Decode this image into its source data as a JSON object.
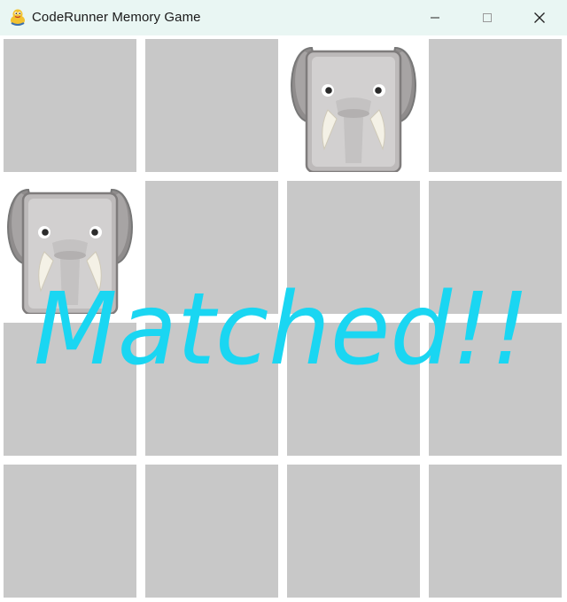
{
  "window": {
    "title": "CodeRunner Memory Game",
    "icon": "python-snake-icon",
    "controls": [
      "minimize-icon",
      "maximize-icon",
      "close-icon"
    ]
  },
  "board": {
    "rows": 4,
    "cols": 4,
    "hidden_color": "#c8c8c8",
    "tiles": [
      {
        "row": 0,
        "col": 0,
        "state": "hidden"
      },
      {
        "row": 0,
        "col": 1,
        "state": "hidden"
      },
      {
        "row": 0,
        "col": 2,
        "state": "revealed",
        "image": "elephant-icon"
      },
      {
        "row": 0,
        "col": 3,
        "state": "hidden"
      },
      {
        "row": 1,
        "col": 0,
        "state": "revealed",
        "image": "elephant-icon"
      },
      {
        "row": 1,
        "col": 1,
        "state": "hidden"
      },
      {
        "row": 1,
        "col": 2,
        "state": "hidden"
      },
      {
        "row": 1,
        "col": 3,
        "state": "hidden"
      },
      {
        "row": 2,
        "col": 0,
        "state": "hidden"
      },
      {
        "row": 2,
        "col": 1,
        "state": "hidden"
      },
      {
        "row": 2,
        "col": 2,
        "state": "hidden"
      },
      {
        "row": 2,
        "col": 3,
        "state": "hidden"
      },
      {
        "row": 3,
        "col": 0,
        "state": "hidden"
      },
      {
        "row": 3,
        "col": 1,
        "state": "hidden"
      },
      {
        "row": 3,
        "col": 2,
        "state": "hidden"
      },
      {
        "row": 3,
        "col": 3,
        "state": "hidden"
      }
    ]
  },
  "message": {
    "text": "Matched!!",
    "color": "#1ad6f2"
  }
}
